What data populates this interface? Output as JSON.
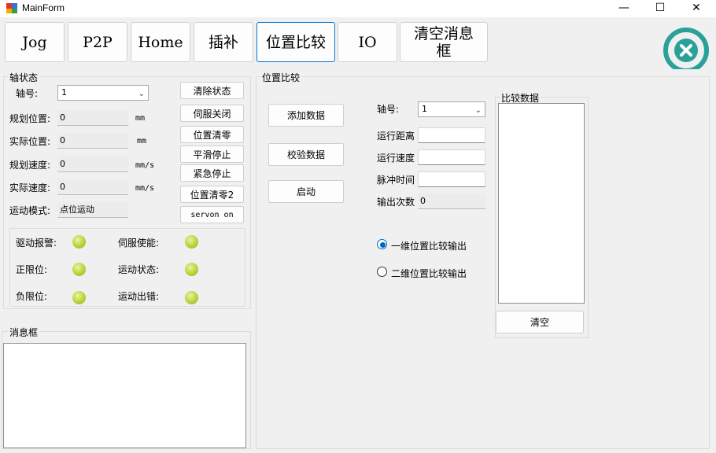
{
  "window": {
    "title": "MainForm",
    "minimize": "—",
    "maximize": "☐",
    "close": "✕"
  },
  "tabs": [
    {
      "label": "Jog"
    },
    {
      "label": "P2P"
    },
    {
      "label": "Home"
    },
    {
      "label": "插补"
    },
    {
      "label": "位置比较"
    },
    {
      "label": "IO"
    },
    {
      "label": "清空消息框"
    }
  ],
  "axis_state": {
    "title": "轴状态",
    "axis_label": "轴号:",
    "axis_value": "1",
    "rows": [
      {
        "label": "规划位置:",
        "value": "0",
        "unit": "mm"
      },
      {
        "label": "实际位置:",
        "value": "0",
        "unit": "mm"
      },
      {
        "label": "规划速度:",
        "value": "0",
        "unit": "mm/s"
      },
      {
        "label": "实际速度:",
        "value": "0",
        "unit": "mm/s"
      }
    ],
    "mode_label": "运动模式:",
    "mode_value": "点位运动",
    "buttons": [
      "清除状态",
      "伺服关闭",
      "位置清零",
      "平滑停止",
      "紧急停止",
      "位置清零2",
      "servon on"
    ],
    "indicators": [
      "驱动报警:",
      "伺服使能:",
      "正限位:",
      "运动状态:",
      "负限位:",
      "运动出错:"
    ],
    "indicator_color": "#b7d33a"
  },
  "message_box": {
    "title": "消息框"
  },
  "position_compare": {
    "title": "位置比较",
    "buttons": [
      "添加数据",
      "校验数据",
      "启动"
    ],
    "axis_label": "轴号:",
    "axis_value": "1",
    "fields": [
      {
        "label": "运行距离",
        "value": ""
      },
      {
        "label": "运行速度",
        "value": ""
      },
      {
        "label": "脉冲时间",
        "value": ""
      }
    ],
    "output_count_label": "输出次数",
    "output_count_value": "0",
    "radio_1d": "一维位置比较输出",
    "radio_2d": "二维位置比较输出",
    "selected_radio": "一维位置比较输出",
    "compare_data_title": "比较数据",
    "clear_button": "清空"
  },
  "accent_color": "#0078d7",
  "close_badge_color": "#2aa198"
}
